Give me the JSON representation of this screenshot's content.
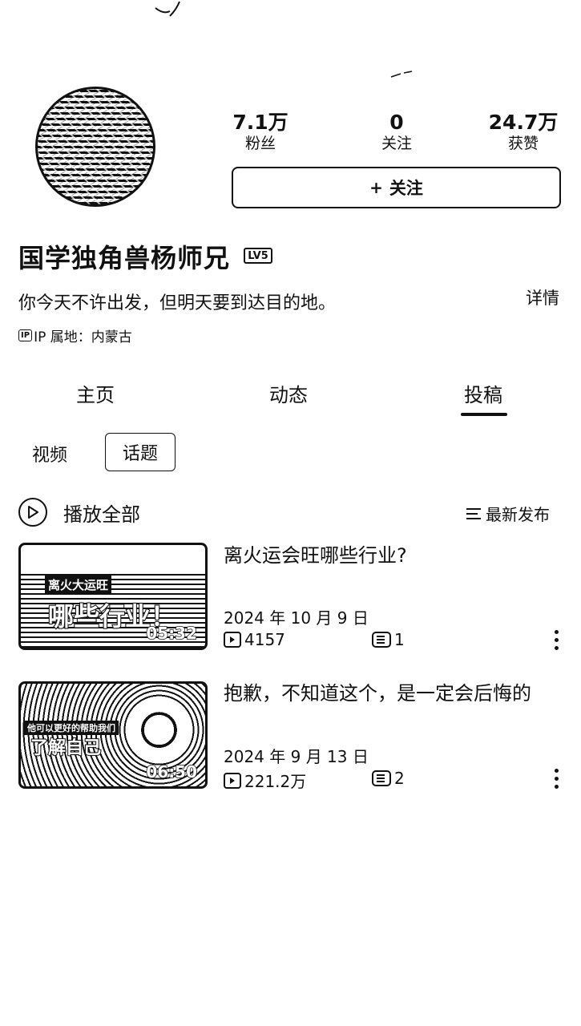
{
  "profile": {
    "name": "国学独角兽杨师兄",
    "level_badge": "LV5",
    "bio": "你今天不许出发，但明天要到达目的地。",
    "detail_label": "详情",
    "ip_badge": "IP",
    "ip_location": "IP 属地：内蒙古"
  },
  "stats": [
    {
      "value": "7.1万",
      "label": "粉丝"
    },
    {
      "value": "0",
      "label": "关注"
    },
    {
      "value": "24.7万",
      "label": "获赞"
    }
  ],
  "follow_button": {
    "icon": "plus-icon",
    "label": "关注"
  },
  "tabs": [
    {
      "label": "主页",
      "active": false
    },
    {
      "label": "动态",
      "active": false
    },
    {
      "label": "投稿",
      "active": true
    }
  ],
  "sub_tabs": [
    {
      "label": "视频",
      "active": false
    },
    {
      "label": "话题",
      "active": true
    }
  ],
  "playlist": {
    "play_all_label": "播放全部",
    "sort_label": "最新发布"
  },
  "videos": [
    {
      "title": "离火运会旺哪些行业?",
      "date": "2024 年 10 月 9 日",
      "views": "4157",
      "comments": "1",
      "duration": "05:32",
      "thumb_caption": "离火大运旺",
      "thumb_big_text": "哪些行业！"
    },
    {
      "title": "抱歉，不知道这个，是一定会后悔的",
      "date": "2024 年 9 月 13 日",
      "views": "221.2万",
      "comments": "2",
      "duration": "06:50",
      "thumb_caption": "他可以更好的帮助我们",
      "thumb_big_text": "了解自己"
    }
  ]
}
